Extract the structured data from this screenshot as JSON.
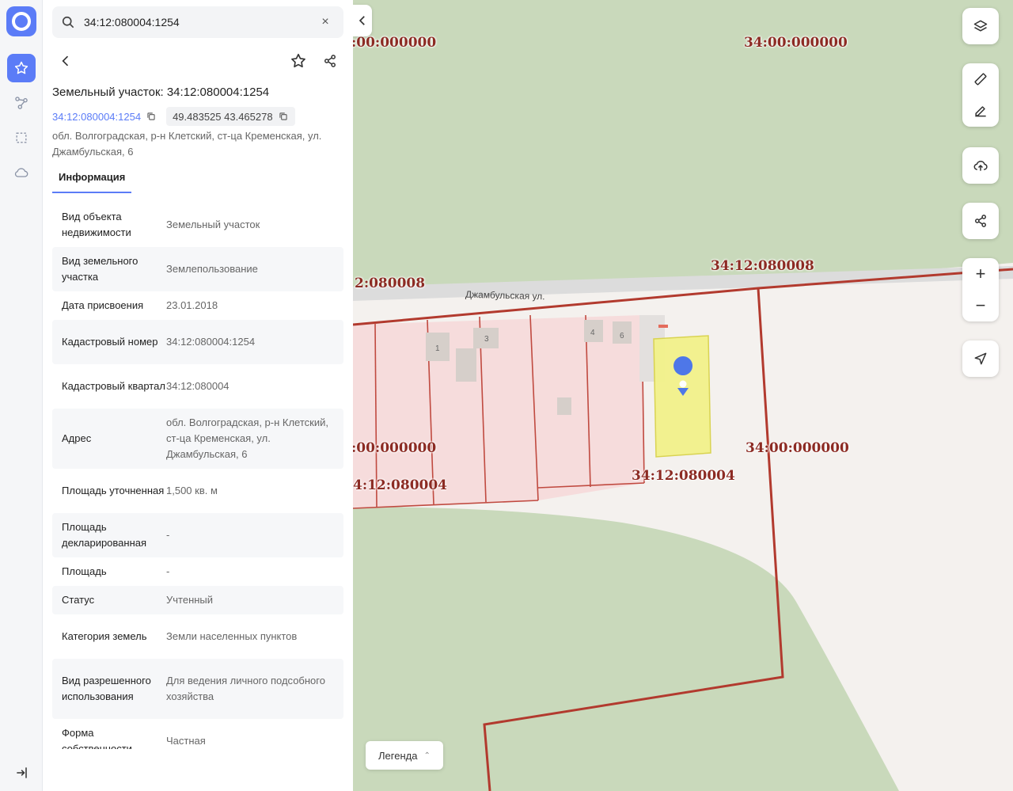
{
  "search": {
    "value": "34:12:080004:1254",
    "clear_label": "×"
  },
  "panel": {
    "title": "Земельный участок: 34:12:080004:1254",
    "cad_link": "34:12:080004:1254",
    "coords": "49.483525 43.465278",
    "address": "обл. Волгоградская, р-н Клетский, ст-ца Кременская, ул. Джамбульская, 6",
    "tab": "Информация",
    "rows": [
      {
        "k": "Вид объекта недвижимости",
        "v": "Земельный участок"
      },
      {
        "k": "Вид земельного участка",
        "v": "Землепользование"
      },
      {
        "k": "Дата присвоения",
        "v": "23.01.2018"
      },
      {
        "k": "Кадастровый номер",
        "v": "34:12:080004:1254"
      },
      {
        "k": "Кадастровый квартал",
        "v": "34:12:080004"
      },
      {
        "k": "Адрес",
        "v": "обл. Волгоградская, р-н Клетский, ст-ца Кременская, ул. Джамбульская, 6"
      },
      {
        "k": "Площадь уточненная",
        "v": "1,500 кв. м"
      },
      {
        "k": "Площадь декларированная",
        "v": "-"
      },
      {
        "k": "Площадь",
        "v": "-"
      },
      {
        "k": "Статус",
        "v": "Учтенный"
      },
      {
        "k": "Категория земель",
        "v": "Земли населенных пунктов"
      },
      {
        "k": "Вид разрешенного использования",
        "v": "Для ведения личного подсобного хозяйства"
      },
      {
        "k": "Форма собственности",
        "v": "Частная"
      }
    ]
  },
  "map": {
    "labels": [
      ":00:000000",
      "34:00:000000",
      "34:12:080008",
      "2:080008",
      ":00:000000",
      "34:00:000000",
      "4:12:080004",
      "34:12:080004"
    ],
    "street": "Джамбульская ул.",
    "building_numbers": [
      "1",
      "3",
      "4",
      "6"
    ],
    "legend": "Легенда",
    "legend_chevron": "⌃",
    "zoom_in": "+",
    "zoom_out": "−"
  },
  "colors": {
    "accent": "#5b7cf7",
    "boundary": "#b23a2e",
    "forest": "#c9d9bb",
    "parcel_fill": "#f6dcdc",
    "selected_parcel": "#f2f28a"
  }
}
